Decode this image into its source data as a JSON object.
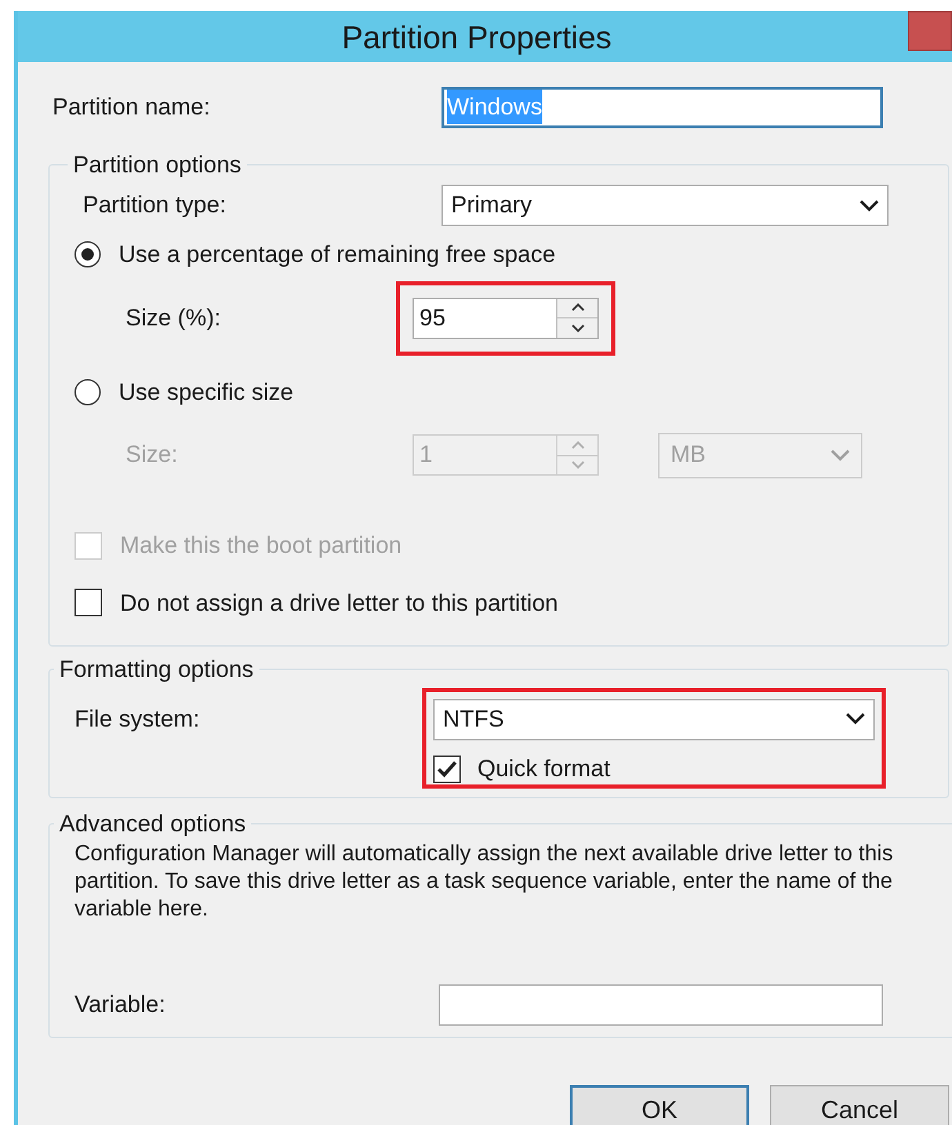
{
  "window": {
    "title": "Partition Properties"
  },
  "partition_name": {
    "label": "Partition name:",
    "value": "Windows",
    "text_selected": true
  },
  "partition_options": {
    "title": "Partition options",
    "type_label": "Partition type:",
    "type_value": "Primary",
    "size_modes": [
      {
        "label": "Use a percentage of remaining free space",
        "selected": true,
        "field_label": "Size (%):",
        "value": "95",
        "disabled": false,
        "highlighted": true
      },
      {
        "label": "Use specific size",
        "selected": false,
        "field_label": "Size:",
        "value": "1",
        "unit": "MB",
        "disabled": true,
        "highlighted": false
      }
    ],
    "checkboxes": [
      {
        "label": "Make this the boot partition",
        "checked": false,
        "disabled": true
      },
      {
        "label": "Do not assign a drive letter to this partition",
        "checked": false,
        "disabled": false
      }
    ]
  },
  "formatting_options": {
    "title": "Formatting options",
    "file_system_label": "File system:",
    "file_system_value": "NTFS",
    "quick_format": {
      "label": "Quick format",
      "checked": true
    },
    "highlighted": true
  },
  "advanced_options": {
    "title": "Advanced options",
    "description": "Configuration Manager will automatically assign the next available drive letter to this partition. To save this drive letter as a task sequence variable, enter the name of the variable here.",
    "variable_label": "Variable:"
  },
  "buttons": [
    {
      "label": "OK",
      "default": true
    },
    {
      "label": "Cancel",
      "default": false
    }
  ]
}
